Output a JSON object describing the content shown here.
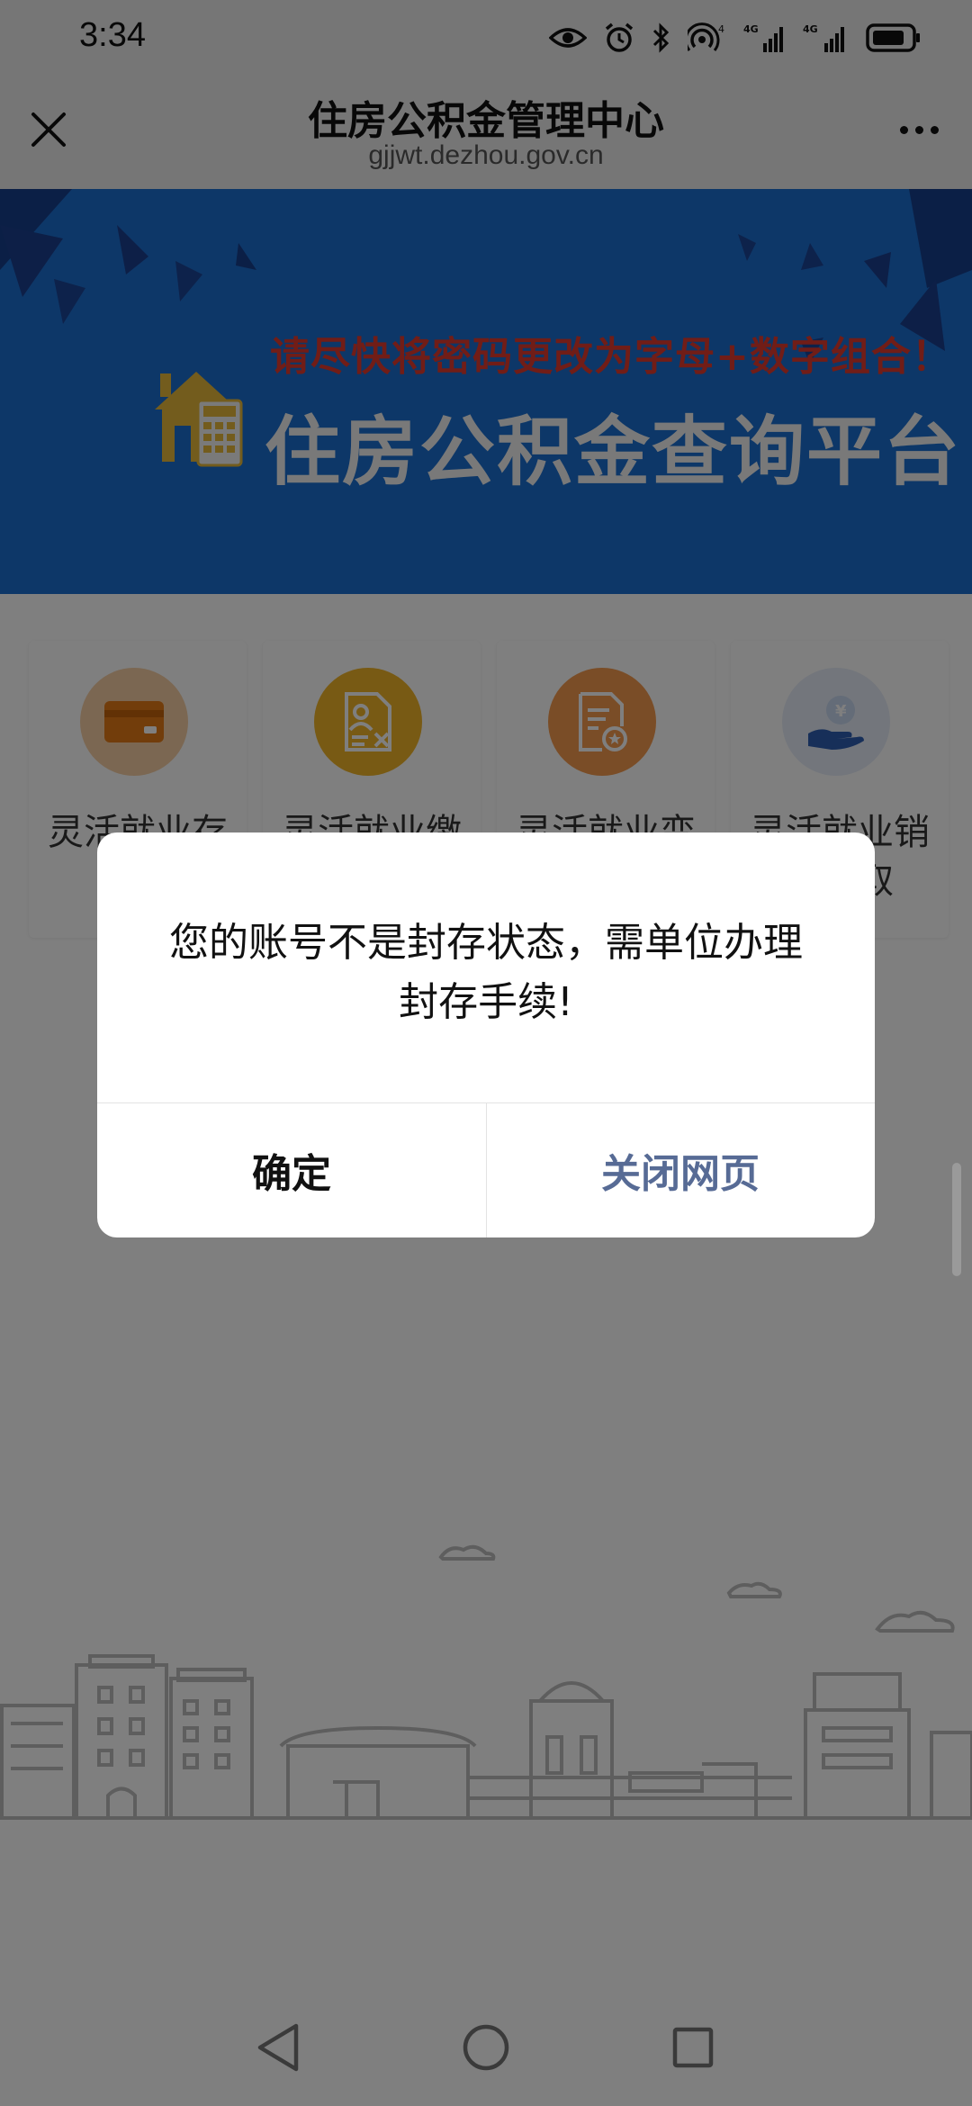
{
  "status_bar": {
    "time": "3:34",
    "icons": [
      "eye-icon",
      "alarm-icon",
      "bluetooth-icon",
      "hotspot-icon",
      "signal-4g-icon",
      "signal-4g-icon",
      "battery-icon"
    ]
  },
  "title_bar": {
    "title": "住房公积金管理中心",
    "url": "gjjwt.dezhou.gov.cn"
  },
  "banner": {
    "notice": "请尽快将密码更改为字母+数字组合！",
    "heading": "住房公积金查询平台",
    "colors": {
      "background": "#1b6fd0",
      "notice": "#e23a2e",
      "heading": "#f2f2f2",
      "house": "#e6b83a"
    }
  },
  "services": [
    {
      "label": "灵活就业存续",
      "icon": "card-icon",
      "color": "#f6cfa5"
    },
    {
      "label": "灵活就业缴存",
      "icon": "document-user-icon",
      "color": "#f0b429"
    },
    {
      "label": "灵活就业变更",
      "icon": "document-star-icon",
      "color": "#f59a4e"
    },
    {
      "label": "灵活就业销户提取",
      "icon": "hand-money-icon",
      "color": "#e6edf8"
    }
  ],
  "dialog": {
    "message": "您的账号不是封存状态，需单位办理封存手续!",
    "confirm_label": "确定",
    "close_label": "关闭网页",
    "colors": {
      "confirm": "#111111",
      "close": "#576b95"
    }
  },
  "nav_bar": {
    "buttons": [
      "back-icon",
      "home-icon",
      "recents-icon"
    ]
  }
}
